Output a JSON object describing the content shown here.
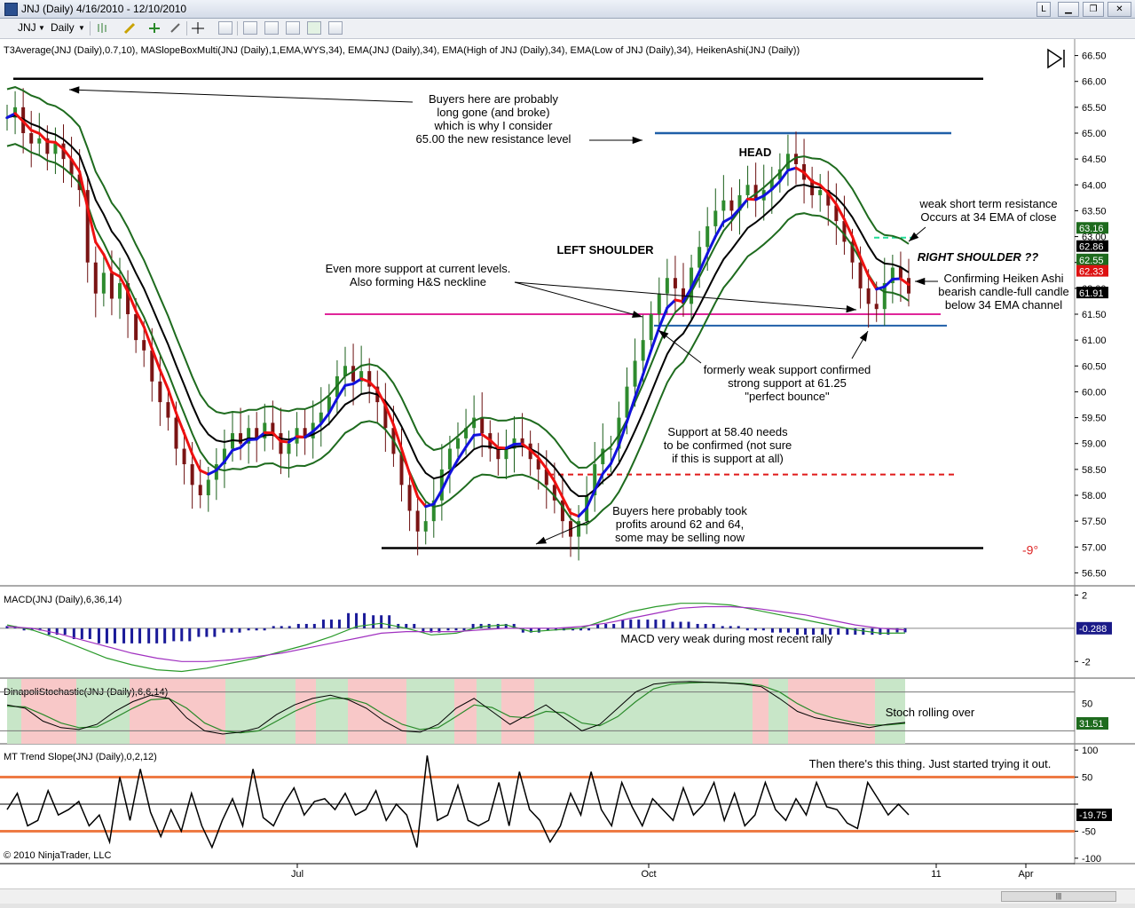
{
  "window": {
    "title": "JNJ (Daily)  4/16/2010 - 12/10/2010",
    "buttons": [
      "L",
      "▭",
      "⧉",
      "✕"
    ]
  },
  "toolbar": {
    "instrument": "JNJ",
    "interval": "Daily",
    "icons": [
      "bar-style-icon",
      "pencil-icon",
      "plus-icon",
      "pointer-icon",
      "crosshair-icon",
      "zoom-icon",
      "indicator-icon",
      "strategy-icon",
      "chart-trader-icon",
      "dollar-icon",
      "properties-icon"
    ]
  },
  "price_panel": {
    "header": "T3Average(JNJ (Daily),0.7,10), MASlopeBoxMulti(JNJ (Daily),1,EMA,WYS,34), EMA(JNJ (Daily),34), EMA(High of JNJ (Daily),34), EMA(Low of JNJ (Daily),34), HeikenAshi(JNJ (Daily))",
    "y_ticks": [
      "66.50",
      "66.00",
      "65.50",
      "65.00",
      "64.50",
      "64.00",
      "63.50",
      "63.00",
      "62.50",
      "62.00",
      "61.50",
      "61.00",
      "60.50",
      "60.00",
      "59.50",
      "59.00",
      "58.50",
      "58.00",
      "57.50",
      "57.00",
      "56.50"
    ],
    "badges": [
      {
        "text": "63.16",
        "color": "#1e6b1e"
      },
      {
        "text": "62.86",
        "color": "#000000"
      },
      {
        "text": "62.55",
        "color": "#1e6b1e"
      },
      {
        "text": "62.33",
        "color": "#dd1111"
      },
      {
        "text": "61.91",
        "color": "#000000"
      }
    ],
    "degree_label": "-9°",
    "annotations": [
      {
        "lines": [
          "Buyers here are probably",
          "long gone (and broke)",
          "which is why I consider",
          "65.00 the new resistance level"
        ]
      },
      {
        "lines": [
          "HEAD"
        ]
      },
      {
        "lines": [
          "LEFT SHOULDER"
        ]
      },
      {
        "lines": [
          "RIGHT SHOULDER ??"
        ]
      },
      {
        "lines": [
          "weak short term resistance",
          "Occurs at 34 EMA of close"
        ]
      },
      {
        "lines": [
          "Even more support at current levels.",
          "Also forming H&S neckline"
        ]
      },
      {
        "lines": [
          "Confirming Heiken Ashi",
          "bearish candle-full candle",
          "below 34 EMA channel"
        ]
      },
      {
        "lines": [
          "formerly weak support confirmed",
          "strong support at 61.25",
          "\"perfect bounce\""
        ]
      },
      {
        "lines": [
          "Support at 58.40 needs",
          "to be confirmed (not sure",
          "if this is support at all)"
        ]
      },
      {
        "lines": [
          "Buyers here probably took",
          "profits around 62 and 64,",
          "some may be selling now"
        ]
      }
    ]
  },
  "macd_panel": {
    "header": "MACD(JNJ (Daily),6,36,14)",
    "y_ticks": [
      "2",
      "-2"
    ],
    "badge": "-0.288",
    "note": "MACD very weak during most recent rally"
  },
  "stoch_panel": {
    "header": "DinapoliStochastic(JNJ (Daily),6,6,14)",
    "y_ticks": [
      "50"
    ],
    "badge": "31.51",
    "note": "Stoch rolling over"
  },
  "trend_panel": {
    "header": "MT Trend Slope(JNJ (Daily),0,2,12)",
    "y_ticks": [
      "100",
      "50",
      "0",
      "-50",
      "-100"
    ],
    "badge": "-19.75",
    "note": "Then there's this thing. Just started trying it out."
  },
  "x_axis": {
    "labels": [
      "Jul",
      "Oct",
      "11",
      "Apr"
    ]
  },
  "copyright": "© 2010 NinjaTrader, LLC",
  "colors": {
    "ema_green": "#1e6b1e",
    "ema_black": "#000000",
    "t3_red": "#ee1111",
    "t3_blue": "#1111dd",
    "resistance_blue": "#1f5fa8",
    "neckline_magenta": "#e0259a",
    "support_red_dash": "#e01a1a",
    "ema_dash_cyan": "#22dd99",
    "macd_hist": "#1a1a99",
    "stoch_red_zone": "#f8c8c8",
    "stoch_green_zone": "#c8e6c8",
    "trend_band": "#ee7a44"
  },
  "chart_data": [
    {
      "type": "candlestick",
      "title": "JNJ (Daily)",
      "x_range": [
        "2010-04-16",
        "2010-12-10"
      ],
      "ylim": [
        56.25,
        66.75
      ],
      "close_approx": [
        65.3,
        65.5,
        65.0,
        64.8,
        64.9,
        64.6,
        64.8,
        64.5,
        64.2,
        63.9,
        62.5,
        61.9,
        62.3,
        61.8,
        62.1,
        61.5,
        61.0,
        60.8,
        60.2,
        59.8,
        59.5,
        58.9,
        58.6,
        58.2,
        58.0,
        58.3,
        58.6,
        58.9,
        59.2,
        59.0,
        59.3,
        59.1,
        59.4,
        59.2,
        58.8,
        59.0,
        59.3,
        59.1,
        59.4,
        59.6,
        59.9,
        60.3,
        60.5,
        60.2,
        60.4,
        60.1,
        59.8,
        59.3,
        58.8,
        58.2,
        57.7,
        57.3,
        57.5,
        57.9,
        58.5,
        58.9,
        59.1,
        59.3,
        59.5,
        59.2,
        58.9,
        58.7,
        58.9,
        59.1,
        59.0,
        58.7,
        58.5,
        58.2,
        57.9,
        57.5,
        57.2,
        57.5,
        58.0,
        58.6,
        58.9,
        58.9,
        59.5,
        60.1,
        60.6,
        61.0,
        61.5,
        61.9,
        62.2,
        62.0,
        61.7,
        62.4,
        62.8,
        63.2,
        63.5,
        63.7,
        63.5,
        63.8,
        64.0,
        63.7,
        63.9,
        64.1,
        64.3,
        64.6,
        64.4,
        64.1,
        63.8,
        63.9,
        63.6,
        63.3,
        62.9,
        62.5,
        62.0,
        61.7,
        61.6,
        62.1,
        62.4,
        62.2,
        61.9
      ]
    },
    {
      "type": "line",
      "title": "MACD(JNJ (Daily),6,36,14)",
      "ylim": [
        -3,
        2.5
      ],
      "series": [
        {
          "name": "MACD",
          "values": [
            0.2,
            -0.1,
            -0.6,
            -1.2,
            -1.8,
            -2.2,
            -2.5,
            -2.6,
            -2.4,
            -2.1,
            -1.8,
            -1.4,
            -1.0,
            -0.5,
            0.1,
            0.3,
            0.0,
            -0.4,
            -0.3,
            0.1,
            0.2,
            -0.2,
            -0.1,
            0.0,
            0.5,
            1.0,
            1.3,
            1.5,
            1.5,
            1.4,
            1.1,
            0.8,
            0.5,
            0.2,
            -0.1,
            -0.3,
            -0.288
          ]
        },
        {
          "name": "Signal",
          "values": [
            0.1,
            0.0,
            -0.3,
            -0.7,
            -1.1,
            -1.5,
            -1.8,
            -2.0,
            -2.0,
            -1.9,
            -1.7,
            -1.5,
            -1.2,
            -0.9,
            -0.6,
            -0.3,
            -0.2,
            -0.2,
            -0.2,
            -0.1,
            0.0,
            0.0,
            0.0,
            0.1,
            0.3,
            0.6,
            0.9,
            1.2,
            1.3,
            1.3,
            1.2,
            1.0,
            0.8,
            0.5,
            0.2,
            0.0,
            -0.1
          ]
        }
      ]
    },
    {
      "type": "line",
      "title": "DinapoliStochastic(JNJ (Daily),6,6,14)",
      "ylim": [
        0,
        100
      ],
      "series": [
        {
          "name": "%K",
          "values": [
            60,
            55,
            35,
            25,
            22,
            30,
            50,
            65,
            75,
            70,
            40,
            20,
            15,
            18,
            25,
            45,
            60,
            70,
            75,
            68,
            55,
            35,
            20,
            18,
            30,
            55,
            70,
            50,
            30,
            45,
            60,
            40,
            20,
            30,
            55,
            80,
            92,
            95,
            96,
            95,
            94,
            92,
            88,
            70,
            50,
            40,
            35,
            30,
            25,
            30,
            33
          ]
        },
        {
          "name": "%D",
          "values": [
            58,
            57,
            45,
            32,
            25,
            26,
            40,
            55,
            68,
            70,
            55,
            32,
            20,
            17,
            20,
            35,
            50,
            62,
            70,
            70,
            62,
            45,
            30,
            22,
            25,
            42,
            60,
            56,
            42,
            40,
            50,
            48,
            32,
            28,
            42,
            65,
            85,
            92,
            94,
            95,
            94,
            93,
            90,
            80,
            62,
            48,
            40,
            34,
            29,
            29,
            31.51
          ]
        }
      ]
    },
    {
      "type": "line",
      "title": "MT Trend Slope(JNJ (Daily),0,2,12)",
      "ylim": [
        -110,
        110
      ],
      "series": [
        {
          "name": "Trend Slope",
          "values": [
            -10,
            20,
            -40,
            -30,
            25,
            -20,
            -10,
            5,
            -40,
            -20,
            -70,
            50,
            -30,
            65,
            -15,
            -60,
            -10,
            -50,
            20,
            -40,
            -80,
            -30,
            10,
            -40,
            65,
            -25,
            -40,
            0,
            30,
            -20,
            5,
            10,
            -10,
            20,
            -20,
            -10,
            25,
            -30,
            0,
            -20,
            -80,
            90,
            -30,
            -20,
            35,
            -30,
            -40,
            -30,
            40,
            -40,
            60,
            -10,
            -30,
            -70,
            -40,
            20,
            -20,
            60,
            -10,
            -40,
            40,
            -5,
            -40,
            10,
            -10,
            -30,
            30,
            -20,
            0,
            40,
            -30,
            20,
            -40,
            -20,
            40,
            -10,
            -30,
            10,
            -20,
            40,
            -5,
            -10,
            -35,
            -45,
            40,
            10,
            -20,
            0,
            -19.75
          ]
        }
      ]
    }
  ]
}
